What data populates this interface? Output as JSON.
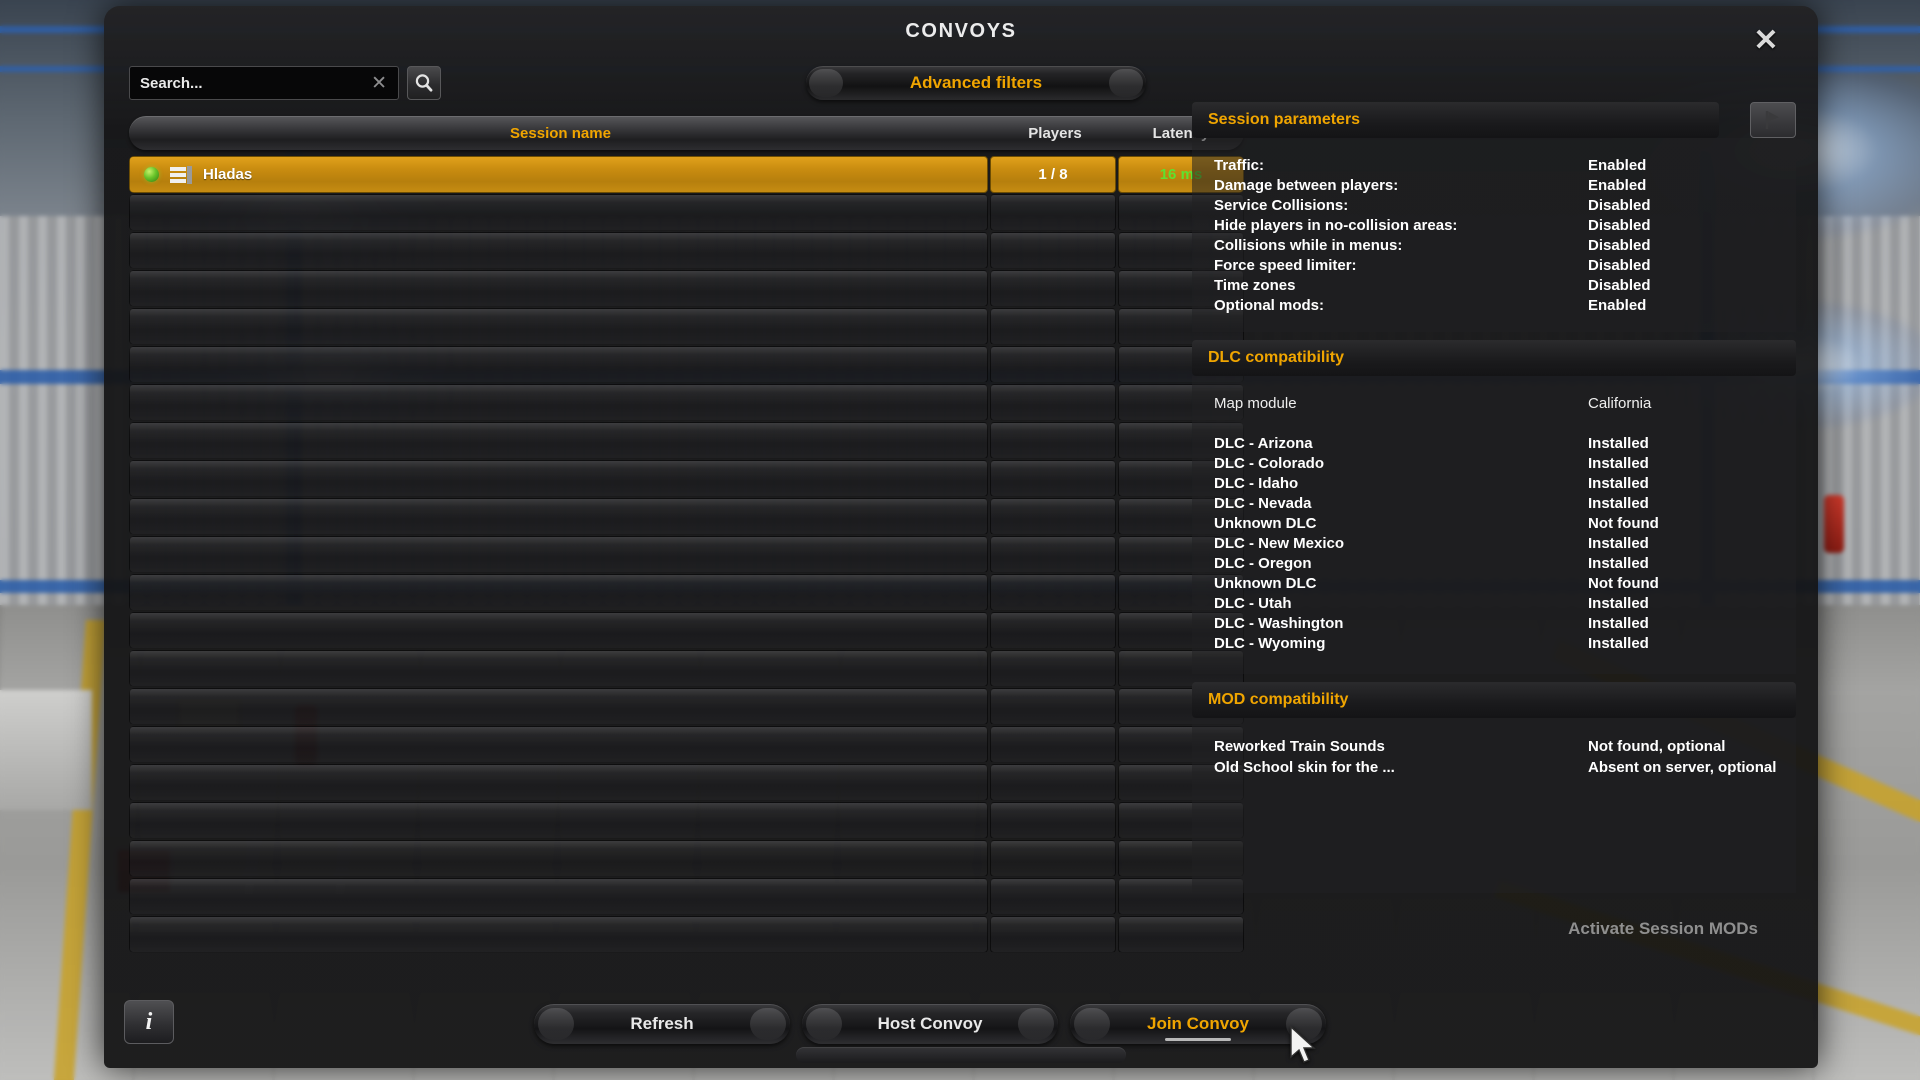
{
  "window": {
    "title": "CONVOYS",
    "close_label": "✕"
  },
  "search": {
    "placeholder": "Search...",
    "value": "",
    "clear_label": "✕",
    "search_icon": "search-icon"
  },
  "filters": {
    "advanced_label": "Advanced filters"
  },
  "table": {
    "headers": {
      "session_name": "Session name",
      "players": "Players",
      "latency": "Latency"
    },
    "rows": [
      {
        "selected": true,
        "status": "online",
        "name": "Hladas",
        "players": "1 / 8",
        "latency": "16 ms"
      }
    ],
    "empty_row_count": 20
  },
  "session_parameters": {
    "title": "Session parameters",
    "flag_icon": "flag-icon",
    "items": [
      {
        "label": "Traffic:",
        "value": "Enabled"
      },
      {
        "label": "Damage between players:",
        "value": "Enabled"
      },
      {
        "label": "Service Collisions:",
        "value": "Disabled"
      },
      {
        "label": "Hide players in no-collision areas:",
        "value": "Disabled"
      },
      {
        "label": "Collisions while in menus:",
        "value": "Disabled"
      },
      {
        "label": "Force speed limiter:",
        "value": "Disabled"
      },
      {
        "label": "Time zones",
        "value": "Disabled"
      },
      {
        "label": "Optional mods:",
        "value": "Enabled"
      }
    ]
  },
  "dlc_compatibility": {
    "title": "DLC compatibility",
    "map_module": {
      "label": "Map module",
      "value": "California"
    },
    "items": [
      {
        "label": "DLC - Arizona",
        "value": "Installed"
      },
      {
        "label": "DLC - Colorado",
        "value": "Installed"
      },
      {
        "label": "DLC - Idaho",
        "value": "Installed"
      },
      {
        "label": "DLC - Nevada",
        "value": "Installed"
      },
      {
        "label": "Unknown DLC",
        "value": "Not found"
      },
      {
        "label": "DLC - New Mexico",
        "value": "Installed"
      },
      {
        "label": "DLC - Oregon",
        "value": "Installed"
      },
      {
        "label": "Unknown DLC",
        "value": "Not found"
      },
      {
        "label": "DLC - Utah",
        "value": "Installed"
      },
      {
        "label": "DLC - Washington",
        "value": "Installed"
      },
      {
        "label": "DLC - Wyoming",
        "value": "Installed"
      }
    ]
  },
  "mod_compatibility": {
    "title": "MOD compatibility",
    "items": [
      {
        "name": "Reworked Train Sounds",
        "state": "Not found, optional"
      },
      {
        "name": "Old School skin for the ...",
        "state": "Absent on server, optional"
      }
    ],
    "activate_label": "Activate Session MODs"
  },
  "footer": {
    "info_label": "i",
    "refresh_label": "Refresh",
    "host_label": "Host Convoy",
    "join_label": "Join Convoy"
  },
  "colors": {
    "accent_orange": "#f0a500",
    "selected_row": "#c98c10",
    "latency_green": "#5ee12f",
    "text_white": "#ffffff",
    "panel_bg": "#202022"
  }
}
